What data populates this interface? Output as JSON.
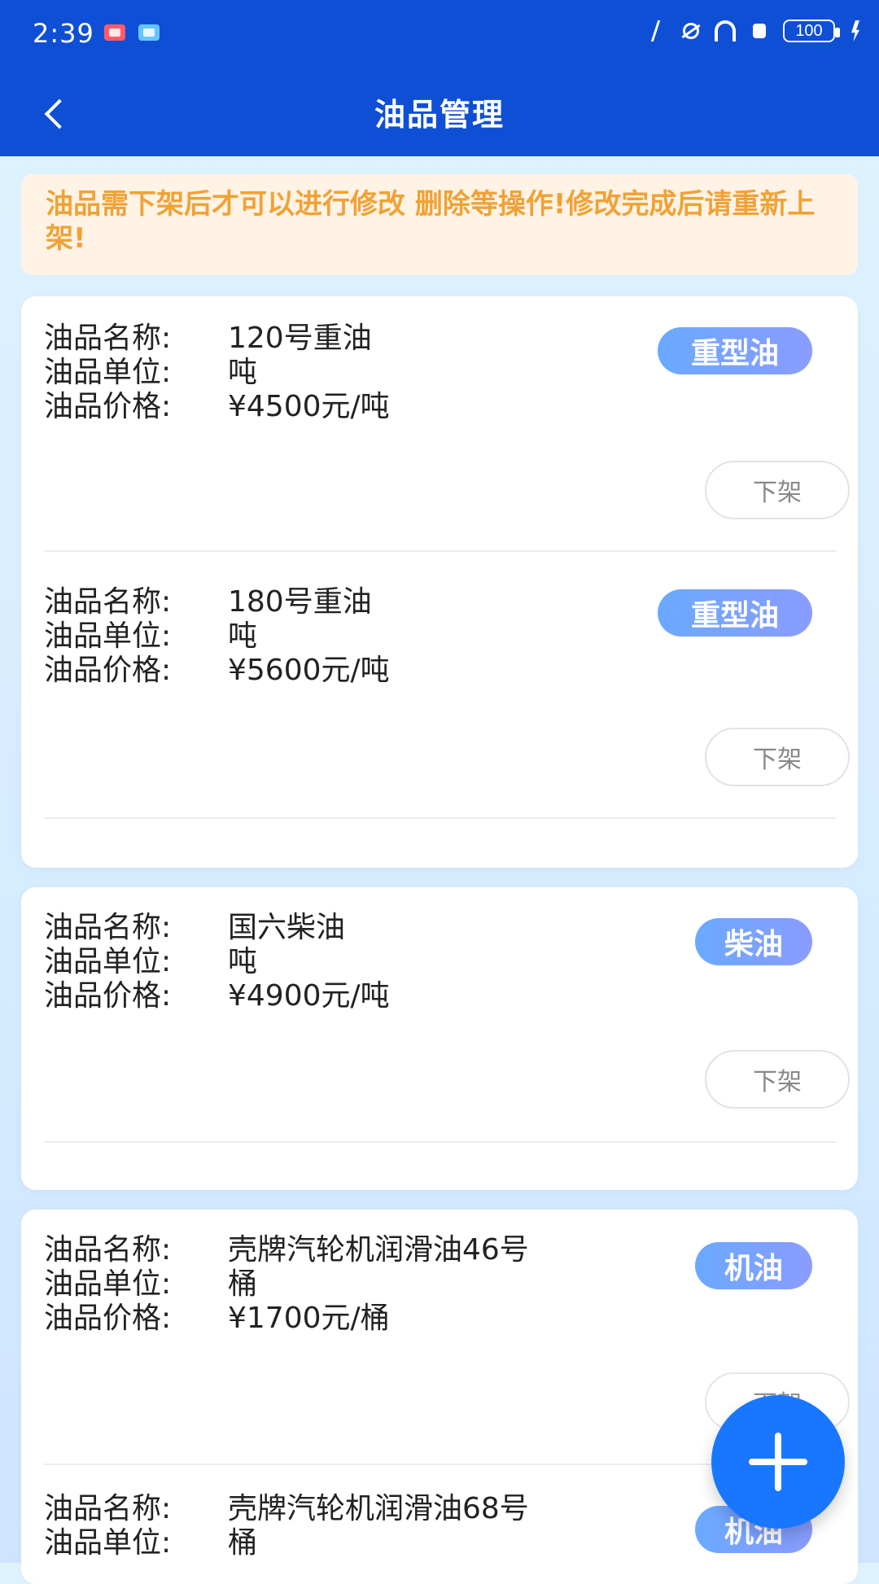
{
  "status_bar": {
    "time": "2:39",
    "battery": "100"
  },
  "app_bar": {
    "title": "油品管理"
  },
  "notice": {
    "text": "油品需下架后才可以进行修改 删除等操作!修改完成后请重新上架!"
  },
  "labels": {
    "name": "油品名称:",
    "unit": "油品单位:",
    "price": "油品价格:"
  },
  "actions": {
    "unlist": "下架"
  },
  "oil_items": [
    {
      "name": "120号重油",
      "unit": "吨",
      "price": "¥4500元/吨",
      "category": "重型油"
    },
    {
      "name": "180号重油",
      "unit": "吨",
      "price": "¥5600元/吨",
      "category": "重型油"
    },
    {
      "name": "国六柴油",
      "unit": "吨",
      "price": "¥4900元/吨",
      "category": "柴油"
    },
    {
      "name": "壳牌汽轮机润滑油46号",
      "unit": "桶",
      "price": "¥1700元/桶",
      "category": "机油"
    },
    {
      "name": "壳牌汽轮机润滑油68号",
      "unit": "桶",
      "price": "",
      "category": "机油"
    }
  ],
  "colors": {
    "primary": "#0e4fd6",
    "notice_bg": "#fff3e6",
    "notice_text": "#f0a235",
    "badge_gradient_start": "#6aa9ff",
    "badge_gradient_end": "#8a9cff",
    "fab": "#1976ff"
  },
  "icons": {
    "back": "back-chevron-icon",
    "fab": "plus-icon"
  }
}
